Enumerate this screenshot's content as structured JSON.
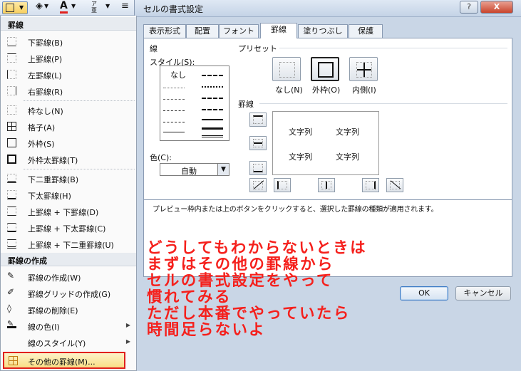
{
  "ribbon": {
    "underline_label": "A",
    "extra_label": "ア亜"
  },
  "dialog": {
    "title": "セルの書式設定",
    "help": "?",
    "close": "X",
    "tabs": [
      "表示形式",
      "配置",
      "フォント",
      "罫線",
      "塗りつぶし",
      "保護"
    ],
    "line_section": "線",
    "style_label": "スタイル(S):",
    "style_none": "なし",
    "color_label": "色(C):",
    "color_value": "自動",
    "preset_label": "プリセット",
    "presets": [
      "なし(N)",
      "外枠(O)",
      "内側(I)"
    ],
    "border_label": "罫線",
    "preview_texts": [
      "文字列",
      "文字列",
      "文字列",
      "文字列"
    ],
    "hint": "プレビュー枠内または上のボタンをクリックすると、選択した罫線の種類が適用されます。",
    "ok": "OK",
    "cancel": "キャンセル"
  },
  "menu": {
    "header1": "罫線",
    "group1": [
      "下罫線(B)",
      "上罫線(P)",
      "左罫線(L)",
      "右罫線(R)"
    ],
    "group2": [
      "枠なし(N)",
      "格子(A)",
      "外枠(S)",
      "外枠太罫線(T)"
    ],
    "group3": [
      "下二重罫線(B)",
      "下太罫線(H)",
      "上罫線 + 下罫線(D)",
      "上罫線 + 下太罫線(C)",
      "上罫線 + 下二重罫線(U)"
    ],
    "header2": "罫線の作成",
    "group4": [
      "罫線の作成(W)",
      "罫線グリッドの作成(G)",
      "罫線の削除(E)",
      "線の色(I)",
      "線のスタイル(Y)"
    ],
    "more": "その他の罫線(M)..."
  },
  "annotation": {
    "lines": [
      "どうしてもわからないときは",
      "まずはその他の罫線から",
      "セルの書式設定をやって",
      "慣れてみる",
      "ただし本番でやっていたら",
      "時間足らないよ"
    ],
    "color": "#f5201c"
  }
}
